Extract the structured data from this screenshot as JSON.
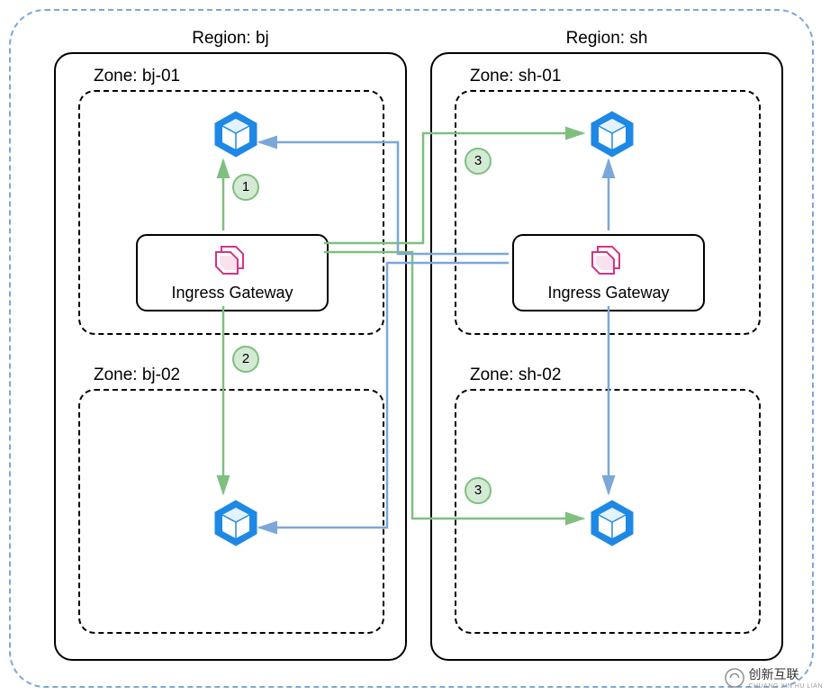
{
  "regions": {
    "bj": {
      "label": "Region: bj"
    },
    "sh": {
      "label": "Region: sh"
    }
  },
  "zones": {
    "bj01": {
      "label": "Zone: bj-01"
    },
    "bj02": {
      "label": "Zone: bj-02"
    },
    "sh01": {
      "label": "Zone: sh-01"
    },
    "sh02": {
      "label": "Zone: sh-02"
    }
  },
  "gateway": {
    "bj": {
      "label": "Ingress Gateway"
    },
    "sh": {
      "label": "Ingress Gateway"
    }
  },
  "badges": {
    "b1": "1",
    "b2": "2",
    "b3a": "3",
    "b3b": "3"
  },
  "watermark": {
    "brand": "创新互联",
    "sub": "CHUANG XIN HU LIAN"
  }
}
